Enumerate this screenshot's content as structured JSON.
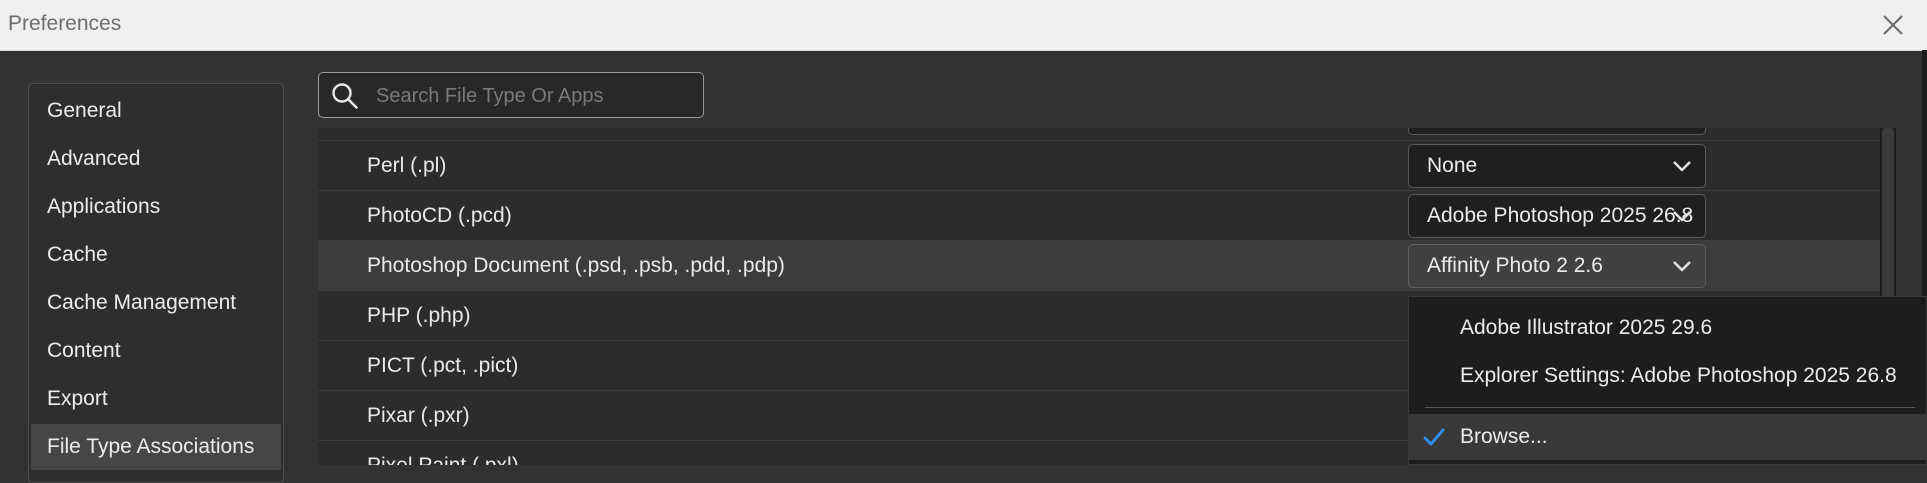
{
  "window": {
    "title": "Preferences"
  },
  "sidebar": {
    "items": [
      {
        "label": "General"
      },
      {
        "label": "Advanced"
      },
      {
        "label": "Applications"
      },
      {
        "label": "Cache"
      },
      {
        "label": "Cache Management"
      },
      {
        "label": "Content"
      },
      {
        "label": "Export"
      },
      {
        "label": "File Type Associations",
        "selected": true
      }
    ]
  },
  "search": {
    "placeholder": "Search File Type Or Apps",
    "value": ""
  },
  "rows": [
    {
      "label": "Perl (.pl)",
      "app": "None"
    },
    {
      "label": "PhotoCD (.pcd)",
      "app": "Adobe Photoshop 2025 26.8"
    },
    {
      "label": "Photoshop Document (.psd, .psb, .pdd, .pdp)",
      "app": "Affinity Photo 2 2.6",
      "open": true
    },
    {
      "label": "PHP (.php)"
    },
    {
      "label": "PICT (.pct, .pict)"
    },
    {
      "label": "Pixar (.pxr)"
    },
    {
      "label": "Pixel Paint (.pxl)"
    }
  ],
  "dropdown_menu": {
    "items": [
      {
        "label": "Adobe Illustrator 2025 29.6"
      },
      {
        "label": "Explorer Settings: Adobe Photoshop 2025 26.8"
      },
      {
        "label": "Browse...",
        "checked": true
      }
    ]
  },
  "icons": {
    "close": "close-icon",
    "search": "search-icon",
    "chevron": "chevron-down-icon",
    "check": "checkmark-icon"
  },
  "colors": {
    "accent": "#2d8ceb",
    "background": "#323232",
    "titlebar": "#f0f0f0"
  }
}
